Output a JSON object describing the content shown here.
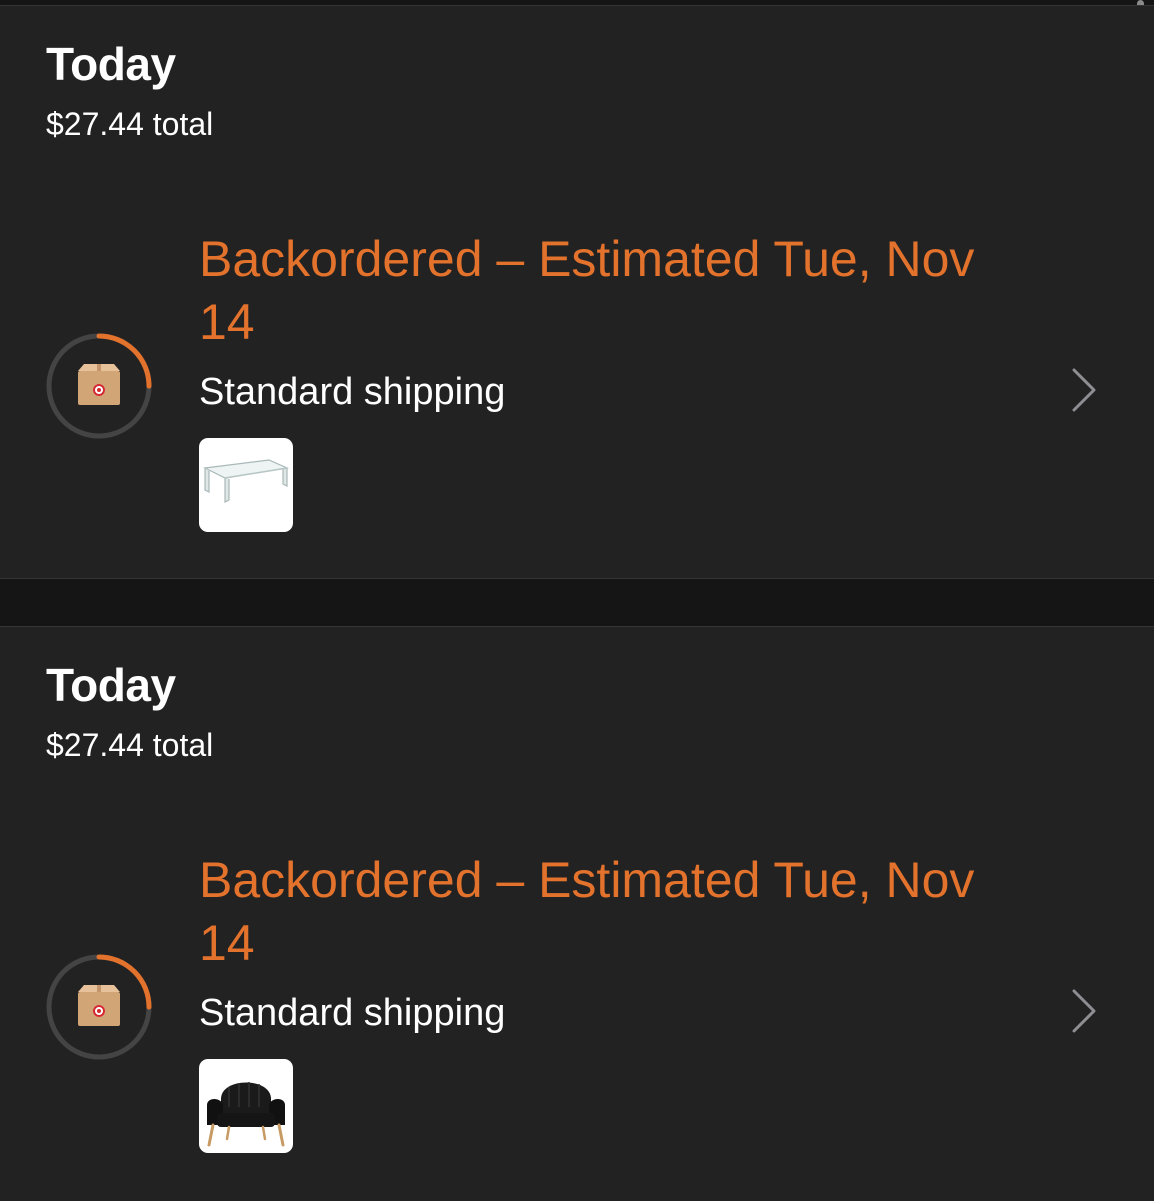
{
  "orders": [
    {
      "date_heading": "Today",
      "total": "$27.44 total",
      "status": "Backordered – Estimated Tue, Nov 14",
      "shipping_method": "Standard shipping",
      "progress": 0.25,
      "item_icon": "glass-shelf-thumbnail"
    },
    {
      "date_heading": "Today",
      "total": "$27.44 total",
      "status": "Backordered – Estimated Tue, Nov 14",
      "shipping_method": "Standard shipping",
      "progress": 0.25,
      "item_icon": "black-armchair-thumbnail"
    }
  ],
  "colors": {
    "background": "#151515",
    "card": "#222222",
    "status_accent": "#e2722c",
    "progress_track": "#444444",
    "text": "#ffffff"
  },
  "icons": {
    "progress": "package-icon",
    "chevron": "chevron-right-icon"
  }
}
